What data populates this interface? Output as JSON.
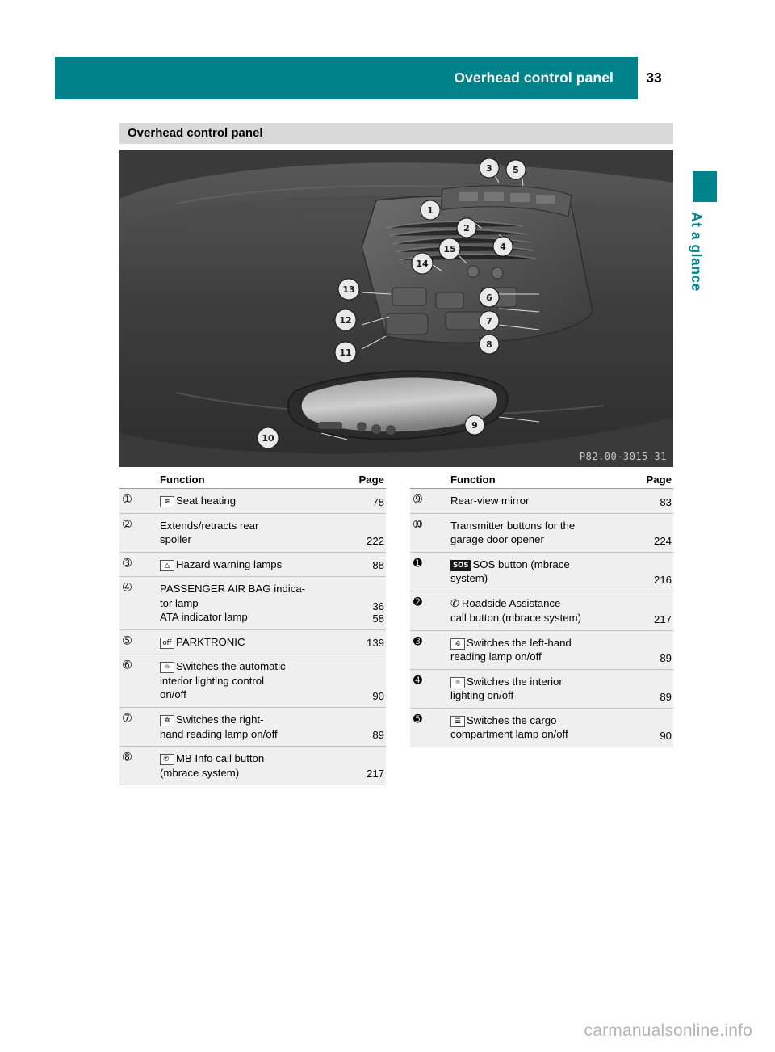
{
  "header": {
    "title": "Overhead control panel",
    "page_number": "33"
  },
  "side_tab": {
    "label": "At a glance"
  },
  "section": {
    "title": "Overhead control panel"
  },
  "illustration": {
    "code": "P82.00-3015-31",
    "callouts": [
      "1",
      "2",
      "3",
      "4",
      "5",
      "6",
      "7",
      "8",
      "9",
      "10",
      "11",
      "12",
      "13",
      "14",
      "15"
    ]
  },
  "tables": {
    "left": {
      "headers": {
        "function": "Function",
        "page": "Page"
      },
      "rows": [
        {
          "num": "1",
          "icon": "seat-heating-icon",
          "icon_glyph": "≋",
          "lines": [
            "Seat heating"
          ],
          "pages": [
            "78"
          ]
        },
        {
          "num": "2",
          "icon": "",
          "icon_glyph": "",
          "lines": [
            "Extends/retracts rear",
            "spoiler"
          ],
          "pages": [
            "",
            "222"
          ]
        },
        {
          "num": "3",
          "icon": "hazard-warning-icon",
          "icon_glyph": "▲",
          "lines": [
            "Hazard warning lamps"
          ],
          "pages": [
            "88"
          ]
        },
        {
          "num": "4",
          "icon": "",
          "icon_glyph": "",
          "lines": [
            "PASSENGER AIR BAG indica-",
            "tor lamp",
            "ATA indicator lamp"
          ],
          "pages": [
            "",
            "36",
            "58"
          ]
        },
        {
          "num": "5",
          "icon": "parktronic-icon",
          "icon_glyph": "off",
          "lines": [
            "PARKTRONIC"
          ],
          "pages": [
            "139"
          ]
        },
        {
          "num": "6",
          "icon": "interior-lighting-auto-icon",
          "icon_glyph": "☼",
          "lines": [
            "Switches the automatic",
            "interior lighting control",
            "on/off"
          ],
          "pages": [
            "",
            "",
            "90"
          ]
        },
        {
          "num": "7",
          "icon": "reading-lamp-right-icon",
          "icon_glyph": "⌼",
          "lines": [
            "Switches the right-",
            "hand reading lamp on/off"
          ],
          "pages": [
            "",
            "89"
          ]
        },
        {
          "num": "8",
          "icon": "mb-info-call-icon",
          "icon_glyph": "✆i",
          "lines": [
            "MB Info call button",
            "(mbrace system)"
          ],
          "pages": [
            "",
            "217"
          ]
        }
      ]
    },
    "right": {
      "headers": {
        "function": "Function",
        "page": "Page"
      },
      "rows": [
        {
          "num": "9",
          "icon": "",
          "icon_glyph": "",
          "lines": [
            "Rear-view mirror"
          ],
          "pages": [
            "83"
          ]
        },
        {
          "num": "10",
          "icon": "",
          "icon_glyph": "",
          "lines": [
            "Transmitter buttons for the",
            "garage door opener"
          ],
          "pages": [
            "",
            "224"
          ]
        },
        {
          "num": "11",
          "icon": "sos-button-icon",
          "icon_glyph": "SOS",
          "lines": [
            "SOS button (mbrace",
            "system)"
          ],
          "pages": [
            "",
            "216"
          ]
        },
        {
          "num": "12",
          "icon": "roadside-assistance-icon",
          "icon_glyph": "✆",
          "lines": [
            "Roadside Assistance",
            "call button (mbrace system)"
          ],
          "pages": [
            "",
            "217"
          ]
        },
        {
          "num": "13",
          "icon": "reading-lamp-left-icon",
          "icon_glyph": "⌼",
          "lines": [
            "Switches the left-hand",
            "reading lamp on/off"
          ],
          "pages": [
            "",
            "89"
          ]
        },
        {
          "num": "14",
          "icon": "interior-lighting-icon",
          "icon_glyph": "☼",
          "lines": [
            "Switches the interior",
            "lighting on/off"
          ],
          "pages": [
            "",
            "89"
          ]
        },
        {
          "num": "15",
          "icon": "cargo-lamp-icon",
          "icon_glyph": "☼",
          "lines": [
            "Switches the cargo",
            "compartment lamp on/off"
          ],
          "pages": [
            "",
            "90"
          ]
        }
      ]
    }
  },
  "footer": {
    "watermark": "carmanualsonline.info"
  },
  "colors": {
    "accent": "#00838a",
    "band": "#d9d9d9",
    "row": "#efefef",
    "illustration_bg": "#3a3a3a"
  }
}
